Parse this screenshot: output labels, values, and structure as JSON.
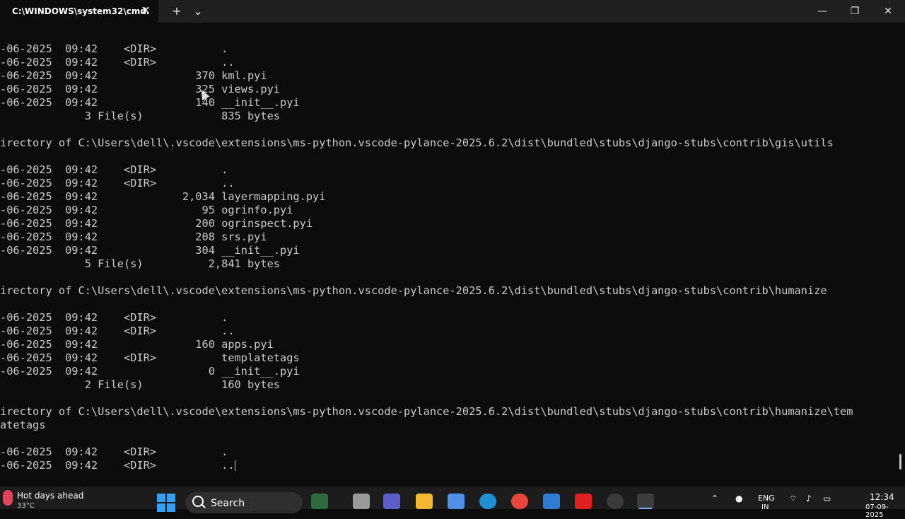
{
  "window": {
    "tab_title": "C:\\WINDOWS\\system32\\cmd.",
    "tab_close": "✕",
    "new_tab": "+",
    "tab_dropdown": "⌄",
    "minimize": "—",
    "restore": "❐",
    "close": "✕"
  },
  "console_lines": [
    "-06-2025  09:42    <DIR>          .",
    "-06-2025  09:42    <DIR>          ..",
    "-06-2025  09:42               370 kml.pyi",
    "-06-2025  09:42               325 views.pyi",
    "-06-2025  09:42               140 __init__.pyi",
    "             3 File(s)            835 bytes",
    "",
    "irectory of C:\\Users\\dell\\.vscode\\extensions\\ms-python.vscode-pylance-2025.6.2\\dist\\bundled\\stubs\\django-stubs\\contrib\\gis\\utils",
    "",
    "-06-2025  09:42    <DIR>          .",
    "-06-2025  09:42    <DIR>          ..",
    "-06-2025  09:42             2,034 layermapping.pyi",
    "-06-2025  09:42                95 ogrinfo.pyi",
    "-06-2025  09:42               200 ogrinspect.pyi",
    "-06-2025  09:42               208 srs.pyi",
    "-06-2025  09:42               304 __init__.pyi",
    "             5 File(s)          2,841 bytes",
    "",
    "irectory of C:\\Users\\dell\\.vscode\\extensions\\ms-python.vscode-pylance-2025.6.2\\dist\\bundled\\stubs\\django-stubs\\contrib\\humanize",
    "",
    "-06-2025  09:42    <DIR>          .",
    "-06-2025  09:42    <DIR>          ..",
    "-06-2025  09:42               160 apps.pyi",
    "-06-2025  09:42    <DIR>          templatetags",
    "-06-2025  09:42                 0 __init__.pyi",
    "             2 File(s)            160 bytes",
    "",
    "irectory of C:\\Users\\dell\\.vscode\\extensions\\ms-python.vscode-pylance-2025.6.2\\dist\\bundled\\stubs\\django-stubs\\contrib\\humanize\\tem",
    "atetags",
    "",
    "-06-2025  09:42    <DIR>          .",
    "-06-2025  09:42    <DIR>          .."
  ],
  "taskbar": {
    "weather_title": "Hot days ahead",
    "weather_temp": "33°C",
    "search_label": "Search",
    "lang": "ENG",
    "region": "IN",
    "time": "12:34",
    "date": "07-09-2025"
  },
  "colors": {
    "console_bg": "#0c0c0c",
    "console_fg": "#cccccc",
    "accent": "#33a0f5"
  }
}
